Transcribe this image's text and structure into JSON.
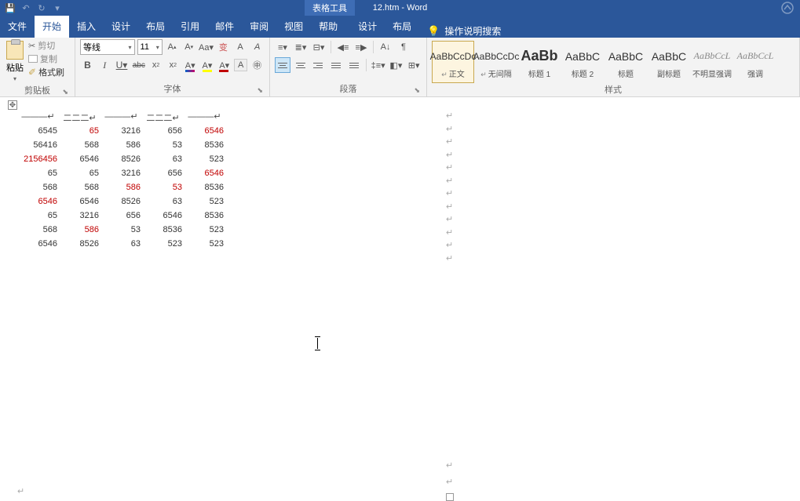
{
  "titlebar": {
    "tabletools": "表格工具",
    "doc_title": "12.htm - Word"
  },
  "tabs": {
    "file": "文件",
    "home": "开始",
    "insert": "插入",
    "design": "设计",
    "layout": "布局",
    "references": "引用",
    "mailings": "邮件",
    "review": "审阅",
    "view": "视图",
    "help": "帮助",
    "table_design": "设计",
    "table_layout": "布局",
    "tell_me": "操作说明搜索"
  },
  "clipboard": {
    "paste": "粘贴",
    "cut": "剪切",
    "copy": "复制",
    "format_painter": "格式刷",
    "label": "剪贴板"
  },
  "font": {
    "name": "等线",
    "size": "11",
    "label": "字体"
  },
  "paragraph": {
    "label": "段落"
  },
  "styles": {
    "label": "样式",
    "items": [
      {
        "preview": "AaBbCcDc",
        "name": "正文",
        "corner": "↵"
      },
      {
        "preview": "AaBbCcDc",
        "name": "无间隔",
        "corner": "↵"
      },
      {
        "preview": "AaBb",
        "name": "标题 1",
        "corner": ""
      },
      {
        "preview": "AaBbC",
        "name": "标题 2",
        "corner": ""
      },
      {
        "preview": "AaBbC",
        "name": "标题",
        "corner": ""
      },
      {
        "preview": "AaBbC",
        "name": "副标题",
        "corner": ""
      },
      {
        "preview": "AaBbCcL",
        "name": "不明显强调",
        "corner": ""
      },
      {
        "preview": "AaBbCcL",
        "name": "强调",
        "corner": ""
      }
    ]
  },
  "table": {
    "headers": [
      "———",
      "二二二",
      "———",
      "二二二",
      "———"
    ],
    "rows": [
      [
        {
          "v": "6545"
        },
        {
          "v": "65",
          "r": 1
        },
        {
          "v": "3216"
        },
        {
          "v": "656"
        },
        {
          "v": "6546",
          "r": 1
        }
      ],
      [
        {
          "v": "56416"
        },
        {
          "v": "568"
        },
        {
          "v": "586"
        },
        {
          "v": "53"
        },
        {
          "v": "8536"
        }
      ],
      [
        {
          "v": "2156456",
          "r": 1
        },
        {
          "v": "6546"
        },
        {
          "v": "8526"
        },
        {
          "v": "63"
        },
        {
          "v": "523"
        }
      ],
      [
        {
          "v": "65"
        },
        {
          "v": "65"
        },
        {
          "v": "3216"
        },
        {
          "v": "656"
        },
        {
          "v": "6546",
          "r": 1
        }
      ],
      [
        {
          "v": "568"
        },
        {
          "v": "568"
        },
        {
          "v": "586",
          "r": 1
        },
        {
          "v": "53",
          "r": 1
        },
        {
          "v": "8536"
        }
      ],
      [
        {
          "v": "6546",
          "r": 1
        },
        {
          "v": "6546"
        },
        {
          "v": "8526"
        },
        {
          "v": "63"
        },
        {
          "v": "523"
        }
      ],
      [
        {
          "v": "65"
        },
        {
          "v": "3216"
        },
        {
          "v": "656"
        },
        {
          "v": "6546"
        },
        {
          "v": "8536"
        }
      ],
      [
        {
          "v": "568"
        },
        {
          "v": "586",
          "r": 1
        },
        {
          "v": "53"
        },
        {
          "v": "8536"
        },
        {
          "v": "523"
        }
      ],
      [
        {
          "v": "6546"
        },
        {
          "v": "8526"
        },
        {
          "v": "63"
        },
        {
          "v": "523"
        },
        {
          "v": "523"
        }
      ]
    ]
  }
}
